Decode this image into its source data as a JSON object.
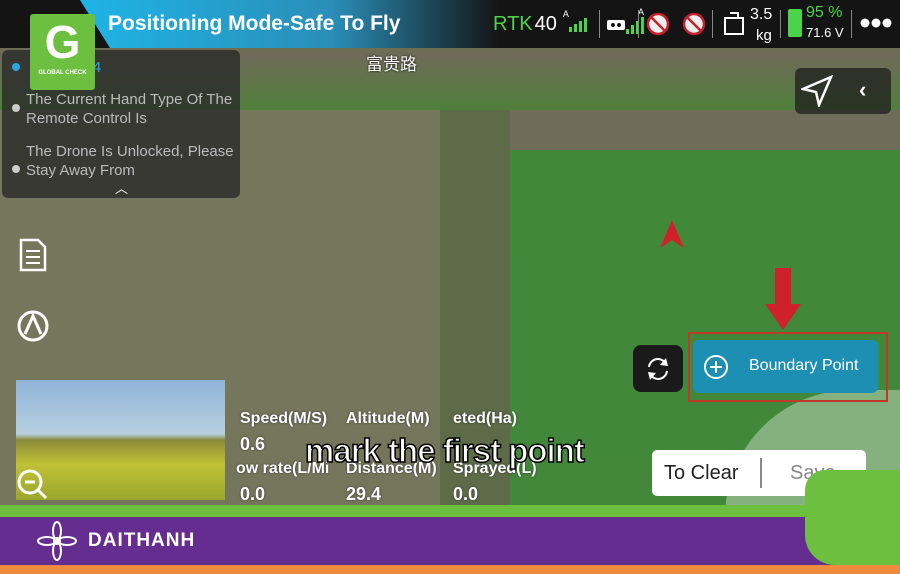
{
  "header": {
    "title": "Positioning Mode-Safe To Fly",
    "street": "富贵路"
  },
  "logo": {
    "text": "GLOBAL CHECK"
  },
  "status": {
    "rtk_label": "RTK",
    "rtk_count": "40",
    "signal_label": "A",
    "rc_label": "A",
    "payload_value": "3.5",
    "payload_unit": "kg",
    "battery_percent": "95 %",
    "battery_voltage": "71.6 V",
    "battery_level": 95
  },
  "notifications": [
    {
      "text": "...74"
    },
    {
      "text": "The Current Hand Type Of The Remote Control Is"
    },
    {
      "text": "The Drone Is Unlocked, Please Stay Away From"
    }
  ],
  "telemetry": {
    "labels": [
      "Speed(M/S)",
      "Altitude(M)",
      "eted(Ha)",
      "ow rate(L/Mi",
      "Distance(M)",
      "Sprayed(L)"
    ],
    "values": [
      "0.6",
      "",
      "",
      "0.0",
      "29.4",
      "0.0"
    ]
  },
  "subtitle": "mark the first point",
  "buttons": {
    "boundary_point": "Boundary Point",
    "clear": "To Clear",
    "save": "Save"
  },
  "footer": {
    "brand": "DAITHANH"
  },
  "colors": {
    "accent": "#1d8fb3",
    "green": "#6cbf3f",
    "purple": "#662d91",
    "orange": "#f08a3c",
    "highlight": "#c0392b"
  }
}
